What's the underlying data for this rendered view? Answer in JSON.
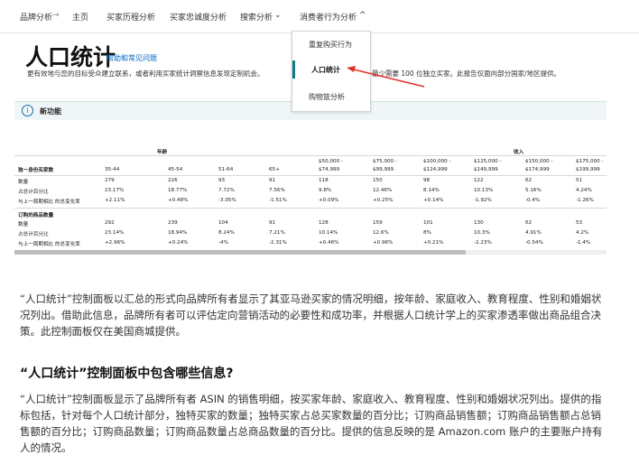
{
  "nav": {
    "items": [
      "品牌分析",
      "主页",
      "买家历程分析",
      "买家忠诚度分析",
      "搜索分析",
      "消费者行为分析"
    ],
    "separator": "→"
  },
  "page": {
    "title": "人口统计",
    "help_link": "帮助和常见问题",
    "description_left": "更有效地与您的目标受众建立联系，或者利用买家统计洞察信息发现定制机会。",
    "description_right": "最少需要 100 位独立买家。此报告仅面向部分国家/地区提供。"
  },
  "banner": {
    "label": "新功能",
    "icon": "info-icon"
  },
  "dropdown": {
    "items": [
      "重复购买行为",
      "人口统计",
      "购物篮分析"
    ],
    "selected": "人口统计"
  },
  "table": {
    "group_age": "年龄",
    "group_income": "收入",
    "columns": [
      "35-44",
      "45-54",
      "51-64",
      "65+",
      "$50,000 -\n$74,999",
      "$75,000 -\n$99,999",
      "$100,000 -\n$124,999",
      "$125,000 -\n$149,999",
      "$150,000 -\n$174,999",
      "$175,000 -\n$199,999"
    ],
    "section1_header": "独一身份买家数",
    "section1_rows": [
      {
        "label": "数量",
        "values": [
          "279",
          "226",
          "93",
          "91",
          "118",
          "150",
          "98",
          "122",
          "62",
          "51"
        ]
      },
      {
        "label": "占总计百分比",
        "values": [
          "23.17%",
          "18.77%",
          "7.72%",
          "7.56%",
          "9.8%",
          "12.46%",
          "8.14%",
          "10.13%",
          "5.16%",
          "4.24%"
        ]
      },
      {
        "label": "与上一周期相比 的总变化率",
        "values": [
          "+2.11%",
          "+0.48%",
          "-3.05%",
          "-1.51%",
          "+0.09%",
          "+0.25%",
          "+0.14%",
          "-1.92%",
          "-0.4%",
          "-1.26%"
        ]
      }
    ],
    "section2_header": "订购的商品数量",
    "section2_rows": [
      {
        "label": "数量",
        "values": [
          "292",
          "239",
          "104",
          "91",
          "128",
          "159",
          "101",
          "130",
          "62",
          "53"
        ]
      },
      {
        "label": "占总计百分比",
        "values": [
          "23.14%",
          "18.94%",
          "8.24%",
          "7.21%",
          "10.14%",
          "12.6%",
          "8%",
          "10.3%",
          "4.91%",
          "4.2%"
        ]
      },
      {
        "label": "与上一周期相比 的总变化率",
        "values": [
          "+2.96%",
          "+0.24%",
          "-4%",
          "-2.31%",
          "+0.46%",
          "+0.96%",
          "+0.21%",
          "-2.23%",
          "-0.54%",
          "-1.4%"
        ]
      }
    ]
  },
  "article": {
    "para1": "“人口统计”控制面板以汇总的形式向品牌所有者显示了其亚马逊买家的情况明细，按年龄、家庭收入、教育程度、性别和婚姻状况列出。借助此信息，品牌所有者可以评估定向营销活动的必要性和成功率，并根据人口统计学上的买家渗透率做出商品组合决策。此控制面板仅在美国商城提供。",
    "heading": "“人口统计”控制面板中包含哪些信息?",
    "para2": "“人口统计”控制面板显示了品牌所有者 ASIN 的销售明细，按买家年龄、家庭收入、教育程度、性别和婚姻状况列出。提供的指标包括，针对每个人口统计部分，独特买家的数量；独特买家占总买家数量的百分比；订购商品销售额；订购商品销售额占总销售额的百分比；订购商品数量；订购商品数量占总商品数量的百分比。提供的信息反映的是 Amazon.com 账户的主要账户持有人的情况。"
  },
  "colors": {
    "link": "#0066c0",
    "accent": "#0f7a8a",
    "annotation_arrow": "#e0302a"
  }
}
